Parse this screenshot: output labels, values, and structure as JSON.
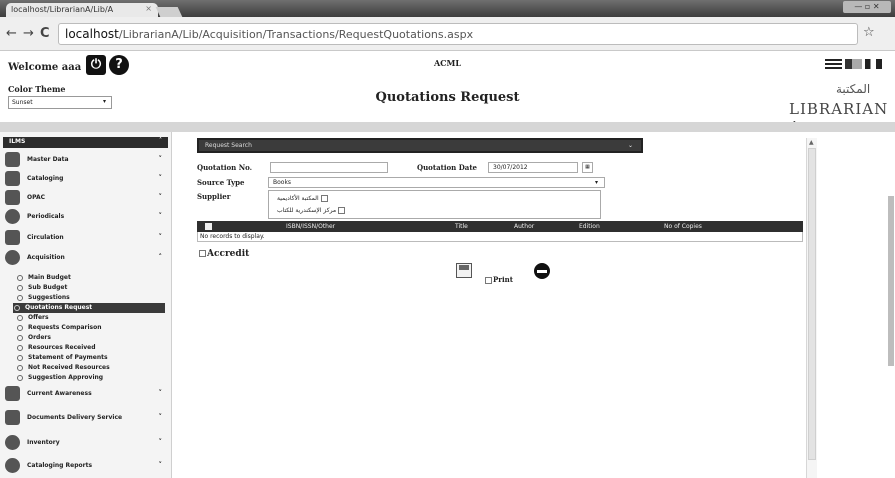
{
  "browser": {
    "tab_title": "localhost/LibrarianA/Lib/A",
    "tab_close": "×",
    "url_host": "localhost",
    "url_path": "/LibrarianA/Lib/Acquisition/Transactions/RequestQuotations.aspx",
    "back_icon": "←",
    "forward_icon": "→",
    "reload_icon": "C",
    "star_icon": "☆"
  },
  "header": {
    "welcome": "Welcome aaa",
    "color_theme_label": "Color Theme",
    "theme_value": "Sunset",
    "org": "ACML",
    "page_title": "Quotations Request",
    "logo_ar": "المكتبة",
    "logo_en": "LIBRARIAN A",
    "power_icon": "⏻",
    "help_icon": "?"
  },
  "sidebar": {
    "title": "ILMS",
    "modules": [
      {
        "label": "Master Data",
        "arrow": "˅"
      },
      {
        "label": "Cataloging",
        "arrow": "˅"
      },
      {
        "label": "OPAC",
        "arrow": "˅"
      },
      {
        "label": "Periodicals",
        "arrow": "˅"
      },
      {
        "label": "Circulation",
        "arrow": "˅"
      },
      {
        "label": "Acquisition",
        "arrow": "˄"
      }
    ],
    "acquisition_items": [
      "Main Budget",
      "Sub Budget",
      "Suggestions",
      "Quotations Request",
      "Offers",
      "Requests Comparison",
      "Orders",
      "Resources Received",
      "Statement of Payments",
      "Not Received Resources",
      "Suggestion Approving"
    ],
    "selected_item": "Quotations Request",
    "bottom_modules": [
      {
        "label": "Current Awareness",
        "arrow": "˅"
      },
      {
        "label": "Documents Delivery Service",
        "arrow": "˅"
      },
      {
        "label": "Inventory",
        "arrow": "˅"
      },
      {
        "label": "Cataloging Reports",
        "arrow": "˅"
      }
    ]
  },
  "form": {
    "search_bar_label": "Request Search",
    "quotation_no_label": "Quotation No.",
    "quotation_no_value": "",
    "quotation_date_label": "Quotation Date",
    "quotation_date_value": "30/07/2012",
    "source_type_label": "Source Type",
    "source_type_value": "Books",
    "supplier_label": "Supplier",
    "suppliers": [
      "المكتبة الأكاديمية",
      "مركز الإسكندرية للكتاب"
    ],
    "grid_columns": [
      "ISBN/ISSN/Other",
      "Title",
      "Author",
      "Edition",
      "No of Copies"
    ],
    "grid_empty": "No records to display.",
    "accredit_label": "Accredit",
    "print_label": "Print"
  }
}
